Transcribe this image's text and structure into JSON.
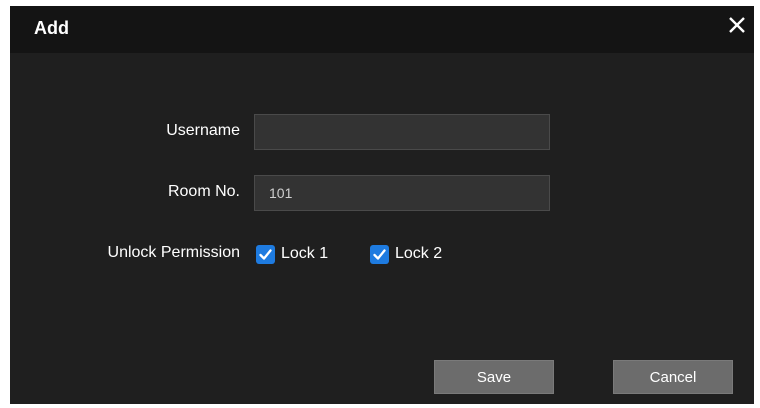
{
  "dialog": {
    "title": "Add"
  },
  "form": {
    "username": {
      "label": "Username",
      "value": ""
    },
    "room_no": {
      "label": "Room No.",
      "value": "101"
    },
    "unlock_permission": {
      "label": "Unlock Permission",
      "options": [
        {
          "label": "Lock 1",
          "checked": true
        },
        {
          "label": "Lock 2",
          "checked": true
        }
      ]
    }
  },
  "buttons": {
    "save": "Save",
    "cancel": "Cancel"
  },
  "icons": {
    "close": "close-icon",
    "check": "check-icon"
  },
  "colors": {
    "dialog_bg": "#1f1f1f",
    "titlebar_bg": "#141414",
    "checkbox_accent": "#1e7be0",
    "button_bg": "#6c6c6c"
  }
}
